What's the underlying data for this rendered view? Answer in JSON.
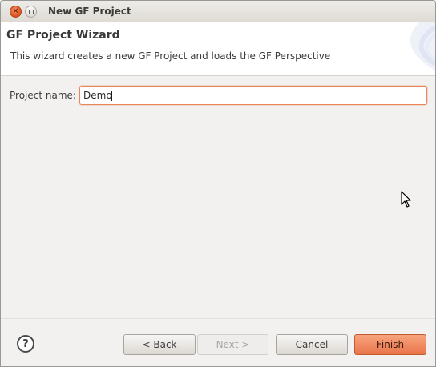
{
  "window": {
    "title": "New GF Project",
    "close_glyph": "×",
    "close_icon": "close-icon",
    "maximize_icon": "maximize-icon"
  },
  "banner": {
    "heading": "GF Project Wizard",
    "description": "This wizard creates a new GF Project and loads the GF Perspective"
  },
  "form": {
    "project_name_label": "Project name:",
    "project_name_value": "Demo"
  },
  "footer": {
    "help_glyph": "?",
    "help_icon": "help-icon",
    "back_label": "< Back",
    "next_label": "Next >",
    "next_enabled": false,
    "cancel_label": "Cancel",
    "finish_label": "Finish"
  },
  "colors": {
    "accent": "#e9744a",
    "focus_border": "#e9865a",
    "background": "#f2f1f0"
  }
}
